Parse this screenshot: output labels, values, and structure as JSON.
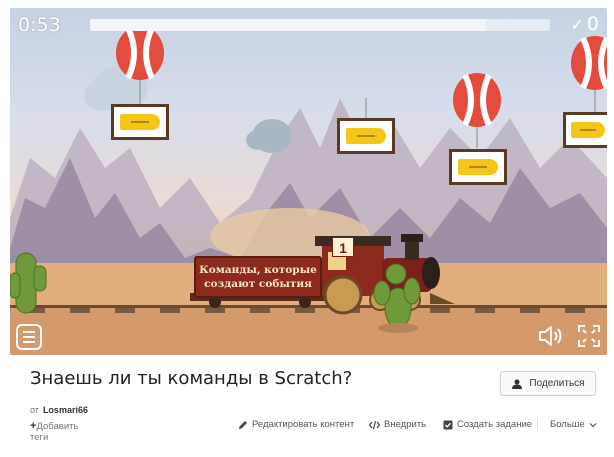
{
  "game": {
    "timer": "0:53",
    "progress_fraction": 0.86,
    "score": "0",
    "board_line1": "Команды, которые",
    "board_line2": "создают события",
    "car_number": "1"
  },
  "activity": {
    "title": "Знаешь ли ты команды в Scratch?",
    "author_prefix": "от",
    "author_name": "Losmari66",
    "add_tags_line1": "Добавить",
    "add_tags_line2": "теги"
  },
  "toolbar": {
    "share_label": "Поделиться",
    "edit_label": "Редактировать контент",
    "embed_label": "Внедрить",
    "assign_label": "Создать задание",
    "more_label": "Больше"
  },
  "icons": {
    "menu": "hamburger-icon",
    "sound": "speaker-icon",
    "fullscreen": "fullscreen-icon",
    "share": "person-share-icon",
    "edit": "pencil-icon",
    "embed": "code-icon",
    "assign": "checkbox-icon",
    "more": "chevron-down-icon"
  }
}
